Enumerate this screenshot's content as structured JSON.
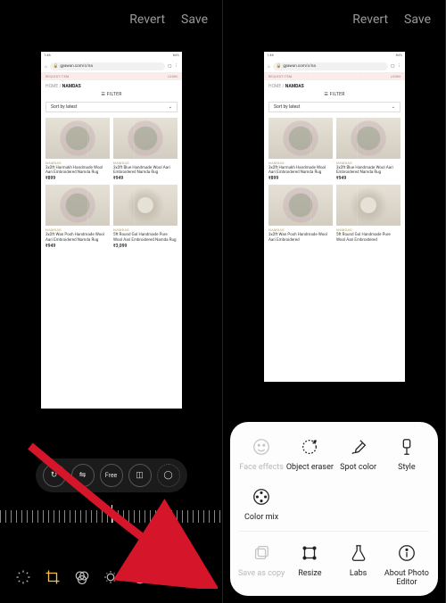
{
  "header": {
    "revert": "Revert",
    "save": "Save"
  },
  "status": {
    "time": "1:46",
    "right": "84%"
  },
  "browser": {
    "url": "gyawun.com/c/na",
    "reqline_left": "REQUEST ITEM",
    "reqline_right": "LOGIN",
    "crumb_home": "HOME",
    "crumb_sep": " / ",
    "crumb_current": "NAMDAS",
    "filter": "FILTER",
    "sort": "Sort by latest"
  },
  "products": [
    {
      "cat": "NAMDAS",
      "title": "3x2ft Harmukh Handmade Wool Aari Embroidered Namda Rug",
      "price": "₹899"
    },
    {
      "cat": "NAMDAS",
      "title": "3x2ft Blue Handmade Wool Aari Embroidered Namda Rug",
      "price": "₹949"
    },
    {
      "cat": "NAMDAS",
      "title": "3x2ft Wan Posh Handmade Wool Aari Embroidered Namda Rug",
      "price": "₹949"
    },
    {
      "cat": "NAMDAS",
      "title": "5ft Round Gol Handmade Pure Wool Aari Embroidered Namda Rug",
      "price": "₹3,099"
    }
  ],
  "products_short": [
    {
      "cat": "NAMDAS",
      "title": "3x2ft Harmukh Handmade Wool Aari Embroidered Namda Rug",
      "price": "₹899"
    },
    {
      "cat": "NAMDAS",
      "title": "3x2ft Blue Handmade Wool Aari Embroidered Namda Rug",
      "price": "₹949"
    },
    {
      "cat": "NAMDAS",
      "title": "3x2ft Wan Posh Handmade Wool Aari Embroidered",
      "price": ""
    },
    {
      "cat": "NAMDAS",
      "title": "5ft Round Gol Handmade Pure Wool Aari Embroidered",
      "price": ""
    }
  ],
  "pills": {
    "free": "Free"
  },
  "bottom": {
    "more": "⋮"
  },
  "sheet": {
    "row1": [
      {
        "label": "Face effects",
        "disabled": true
      },
      {
        "label": "Object eraser",
        "disabled": false
      },
      {
        "label": "Spot color",
        "disabled": false
      },
      {
        "label": "Style",
        "disabled": false
      }
    ],
    "row2": [
      {
        "label": "Color mix",
        "disabled": false
      }
    ],
    "row3": [
      {
        "label": "Save as copy",
        "disabled": true
      },
      {
        "label": "Resize",
        "disabled": false
      },
      {
        "label": "Labs",
        "disabled": false
      },
      {
        "label": "About Photo Editor",
        "disabled": false
      }
    ]
  }
}
